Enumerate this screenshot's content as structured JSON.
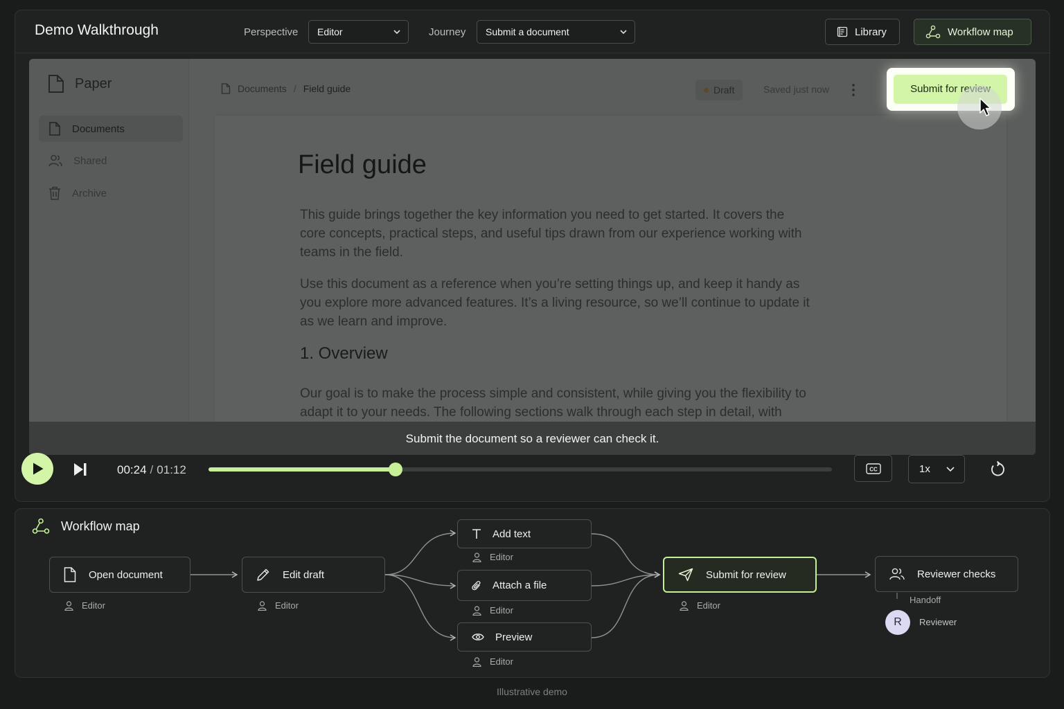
{
  "app": {
    "title": "Demo Walkthrough",
    "perspective_label": "Perspective",
    "perspective_value": "Editor",
    "journey_label": "Journey",
    "journey_value": "Submit a document",
    "library_label": "Library",
    "workflow_map_label": "Workflow map",
    "accent_color": "#d2f5a8"
  },
  "screen": {
    "brand": "Paper",
    "nav": [
      {
        "label": "Documents",
        "icon": "file-icon",
        "active": true
      },
      {
        "label": "Shared",
        "icon": "users-icon",
        "active": false
      },
      {
        "label": "Archive",
        "icon": "trash-icon",
        "active": false
      }
    ],
    "breadcrumb": {
      "root": "Documents",
      "separator": "/",
      "current": "Field guide"
    },
    "status_badge": "Draft",
    "saved_text": "Saved just now",
    "submit_label": "Submit for review",
    "doc": {
      "title": "Field guide",
      "paragraphs": [
        "This guide brings together the key information you need to get started. It covers the core concepts, practical steps, and useful tips drawn from our experience working with teams in the field.",
        "Use this document as a reference when you’re setting things up, and keep it handy as you explore more advanced features. It’s a living resource, so we’ll continue to update it as we learn and improve."
      ],
      "section_heading": "1. Overview",
      "section_paragraph": "Our goal is to make the process simple and consistent, while giving you the flexibility to adapt it to your needs. The following sections walk through each step in detail, with examples and notes along the way."
    },
    "caption": "Submit the document so a reviewer can check it."
  },
  "player": {
    "current_time": "00:24",
    "separator": "/",
    "total_time": "01:12",
    "progress": 0.3,
    "cc_label": "CC",
    "speed": "1x"
  },
  "workflow": {
    "title": "Workflow map",
    "nodes": [
      {
        "label": "Open document",
        "role": "Editor",
        "icon": "file-icon"
      },
      {
        "label": "Edit draft",
        "role": "Editor",
        "icon": "pencil-icon"
      },
      {
        "label": "Add text",
        "role": "Editor",
        "icon": "text-icon"
      },
      {
        "label": "Attach a file",
        "role": "Editor",
        "icon": "paperclip-icon"
      },
      {
        "label": "Preview",
        "role": "Editor",
        "icon": "eye-icon"
      },
      {
        "label": "Submit for review",
        "role": "Editor",
        "icon": "send-icon",
        "active": true
      },
      {
        "label": "Reviewer checks",
        "icon": "users-icon"
      }
    ],
    "handoff_label": "Handoff",
    "reviewer_initial": "R",
    "reviewer_label": "Reviewer"
  },
  "footer": "Illustrative demo"
}
